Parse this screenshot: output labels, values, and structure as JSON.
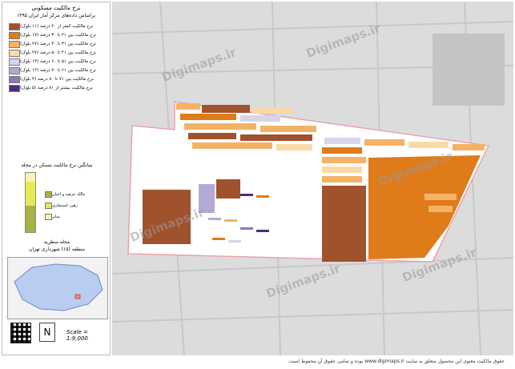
{
  "legend": {
    "title": "نرخ مالکیت مسکونی",
    "subtitle": "براساس داده‌های مرکز آمار ایران ۱۳۹۵",
    "items": [
      {
        "label": "نرخ مالکیت کمتر از ۲۰ درصد (۱۱ بلوک)",
        "color": "#a0522d"
      },
      {
        "label": "نرخ مالکیت بین ۲۱ تا ۳۰ درصد (۱۷ بلوک)",
        "color": "#e07b1a"
      },
      {
        "label": "نرخ مالکیت بین ۳۱ تا ۴۰ درصد (۲۷ بلوک)",
        "color": "#f4b266"
      },
      {
        "label": "نرخ مالکیت بین ۴۱ تا ۵۰ درصد (۲۷ بلوک)",
        "color": "#fbd9a6"
      },
      {
        "label": "نرخ مالکیت بین ۵۱ تا ۶۰ درصد (۱۳ بلوک)",
        "color": "#d8d4e8"
      },
      {
        "label": "نرخ مالکیت بین ۶۱ تا ۷۰ درصد (۱۲ بلوک)",
        "color": "#b3a9d4"
      },
      {
        "label": "نرخ مالکیت بین ۷۱ تا ۸۰ درصد (۴ بلوک)",
        "color": "#8a77b8"
      },
      {
        "label": "نرخ مالکیت بیشتر از ۸۱ درصد (۵ بلوک)",
        "color": "#4b2d7f"
      }
    ]
  },
  "chart": {
    "title": "میانگین نرخ مالکیت مسکن در محله",
    "segments": [
      {
        "label": "مالک عرصه و اعیان",
        "color": "#a8b04a",
        "fraction": 0.45
      },
      {
        "label": "رهن، استیجاری",
        "color": "#e6e85a",
        "fraction": 0.4
      },
      {
        "label": "سایر",
        "color": "#f7f3b0",
        "fraction": 0.15
      }
    ]
  },
  "place": {
    "neighborhood": "محله منظریه",
    "region": "منطقه (۱۵) شهرداری تهران"
  },
  "scale": "Scale = 1:9,000",
  "north": "N",
  "watermark": "Digimaps.ir",
  "copyright": "حقوق مالکیت معنوی این محصول متعلق به سایت www.digimaps.ir بوده و تمامی حقوق آن محفوظ است.",
  "colors": {
    "boundary": "#e8a0a8",
    "roads": "#c8c8c8",
    "background": "#dcdcdc"
  }
}
